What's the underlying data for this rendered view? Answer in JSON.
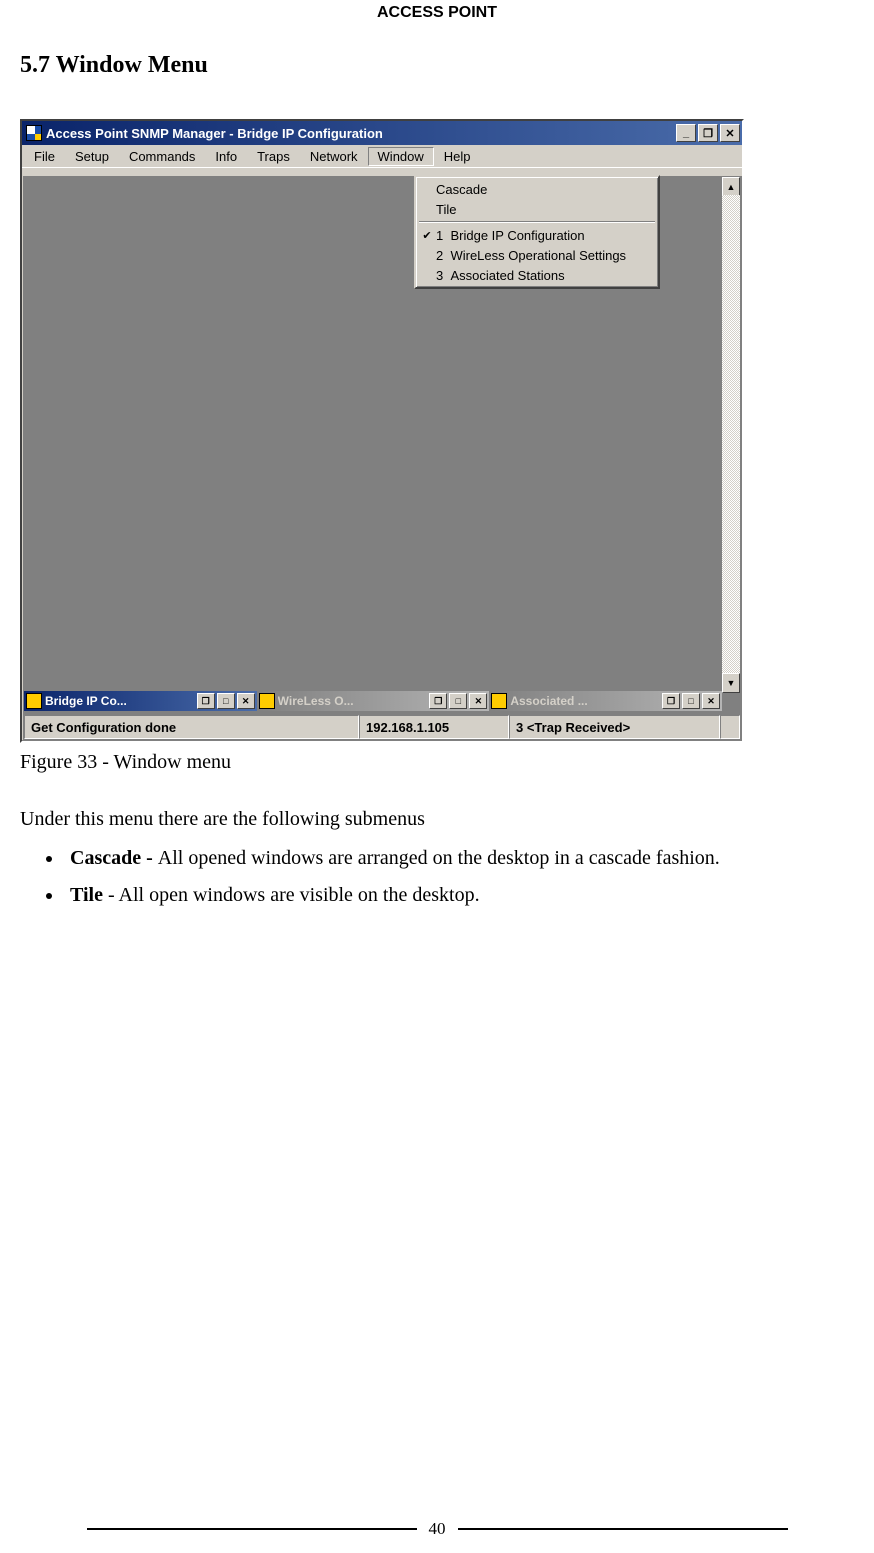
{
  "header": {
    "running": "ACCESS POINT"
  },
  "section": {
    "title": "5.7 Window Menu"
  },
  "app": {
    "title": "Access Point SNMP Manager -  Bridge IP Configuration",
    "menus": [
      "File",
      "Setup",
      "Commands",
      "Info",
      "Traps",
      "Network",
      "Window",
      "Help"
    ],
    "active_menu_index": 6,
    "dropdown": {
      "group1": [
        "Cascade",
        "Tile"
      ],
      "group2": [
        {
          "check": true,
          "num": "1",
          "label": "Bridge IP Configuration"
        },
        {
          "check": false,
          "num": "2",
          "label": "WireLess Operational Settings"
        },
        {
          "check": false,
          "num": "3",
          "label": "Associated Stations"
        }
      ]
    },
    "mdi": [
      {
        "title": "Bridge IP Co...",
        "active": true
      },
      {
        "title": "WireLess O...",
        "active": false
      },
      {
        "title": "Associated ...",
        "active": false
      }
    ],
    "status": {
      "msg": "Get Configuration done",
      "ip": "192.168.1.105",
      "trap": "3 <Trap Received>"
    },
    "winbtn": {
      "min": "_",
      "restore": "❐",
      "close": "✕"
    },
    "scroll": {
      "up": "▲",
      "down": "▼"
    }
  },
  "caption": "Figure 33 - Window menu",
  "intro": "Under this menu there are the following submenus",
  "bullets": [
    {
      "term": "Cascade - ",
      "desc": "All opened windows are arranged on the desktop in a cascade fashion."
    },
    {
      "term": "Tile",
      "join": " - ",
      "desc": "All open windows are visible on the desktop."
    }
  ],
  "page_number": "40"
}
